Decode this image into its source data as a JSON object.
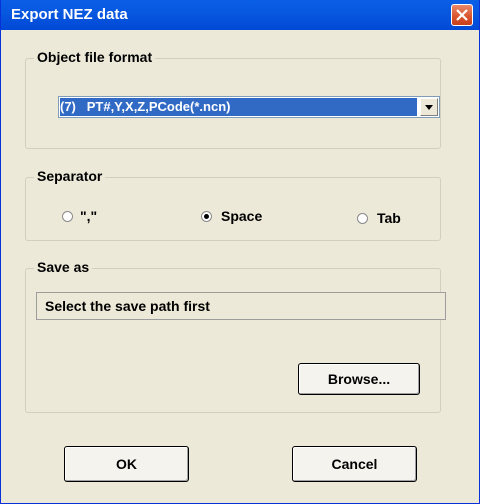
{
  "window": {
    "title": "Export NEZ data",
    "close_icon": "close-x-icon"
  },
  "format_group": {
    "label": "Object file format",
    "selected_value": "(7)   PT#,Y,X,Z,PCode(*.ncn)",
    "dropdown_icon": "chevron-down-icon"
  },
  "separator_group": {
    "label": "Separator",
    "options": [
      {
        "label": "\",\"",
        "selected": false
      },
      {
        "label": "Space",
        "selected": true
      },
      {
        "label": "Tab",
        "selected": false
      }
    ]
  },
  "save_group": {
    "label": "Save as",
    "path_text": "Select the save path first",
    "browse_label": "Browse..."
  },
  "buttons": {
    "ok_label": "OK",
    "cancel_label": "Cancel"
  },
  "colors": {
    "titlebar": "#0058e0",
    "selection": "#316ac5",
    "dialog_bg": "#ece9d8",
    "close_button": "#d9532c"
  }
}
